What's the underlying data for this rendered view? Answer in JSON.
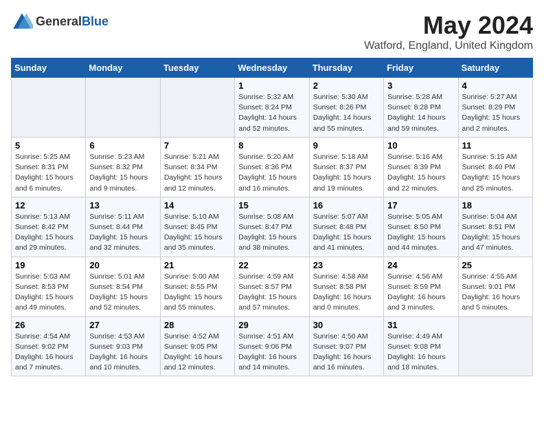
{
  "header": {
    "logo_general": "General",
    "logo_blue": "Blue",
    "month_title": "May 2024",
    "location": "Watford, England, United Kingdom"
  },
  "weekdays": [
    "Sunday",
    "Monday",
    "Tuesday",
    "Wednesday",
    "Thursday",
    "Friday",
    "Saturday"
  ],
  "weeks": [
    [
      {
        "day": "",
        "info": ""
      },
      {
        "day": "",
        "info": ""
      },
      {
        "day": "",
        "info": ""
      },
      {
        "day": "1",
        "info": "Sunrise: 5:32 AM\nSunset: 8:24 PM\nDaylight: 14 hours and 52 minutes."
      },
      {
        "day": "2",
        "info": "Sunrise: 5:30 AM\nSunset: 8:26 PM\nDaylight: 14 hours and 55 minutes."
      },
      {
        "day": "3",
        "info": "Sunrise: 5:28 AM\nSunset: 8:28 PM\nDaylight: 14 hours and 59 minutes."
      },
      {
        "day": "4",
        "info": "Sunrise: 5:27 AM\nSunset: 8:29 PM\nDaylight: 15 hours and 2 minutes."
      }
    ],
    [
      {
        "day": "5",
        "info": "Sunrise: 5:25 AM\nSunset: 8:31 PM\nDaylight: 15 hours and 6 minutes."
      },
      {
        "day": "6",
        "info": "Sunrise: 5:23 AM\nSunset: 8:32 PM\nDaylight: 15 hours and 9 minutes."
      },
      {
        "day": "7",
        "info": "Sunrise: 5:21 AM\nSunset: 8:34 PM\nDaylight: 15 hours and 12 minutes."
      },
      {
        "day": "8",
        "info": "Sunrise: 5:20 AM\nSunset: 8:36 PM\nDaylight: 15 hours and 16 minutes."
      },
      {
        "day": "9",
        "info": "Sunrise: 5:18 AM\nSunset: 8:37 PM\nDaylight: 15 hours and 19 minutes."
      },
      {
        "day": "10",
        "info": "Sunrise: 5:16 AM\nSunset: 8:39 PM\nDaylight: 15 hours and 22 minutes."
      },
      {
        "day": "11",
        "info": "Sunrise: 5:15 AM\nSunset: 8:40 PM\nDaylight: 15 hours and 25 minutes."
      }
    ],
    [
      {
        "day": "12",
        "info": "Sunrise: 5:13 AM\nSunset: 8:42 PM\nDaylight: 15 hours and 29 minutes."
      },
      {
        "day": "13",
        "info": "Sunrise: 5:11 AM\nSunset: 8:44 PM\nDaylight: 15 hours and 32 minutes."
      },
      {
        "day": "14",
        "info": "Sunrise: 5:10 AM\nSunset: 8:45 PM\nDaylight: 15 hours and 35 minutes."
      },
      {
        "day": "15",
        "info": "Sunrise: 5:08 AM\nSunset: 8:47 PM\nDaylight: 15 hours and 38 minutes."
      },
      {
        "day": "16",
        "info": "Sunrise: 5:07 AM\nSunset: 8:48 PM\nDaylight: 15 hours and 41 minutes."
      },
      {
        "day": "17",
        "info": "Sunrise: 5:05 AM\nSunset: 8:50 PM\nDaylight: 15 hours and 44 minutes."
      },
      {
        "day": "18",
        "info": "Sunrise: 5:04 AM\nSunset: 8:51 PM\nDaylight: 15 hours and 47 minutes."
      }
    ],
    [
      {
        "day": "19",
        "info": "Sunrise: 5:03 AM\nSunset: 8:53 PM\nDaylight: 15 hours and 49 minutes."
      },
      {
        "day": "20",
        "info": "Sunrise: 5:01 AM\nSunset: 8:54 PM\nDaylight: 15 hours and 52 minutes."
      },
      {
        "day": "21",
        "info": "Sunrise: 5:00 AM\nSunset: 8:55 PM\nDaylight: 15 hours and 55 minutes."
      },
      {
        "day": "22",
        "info": "Sunrise: 4:59 AM\nSunset: 8:57 PM\nDaylight: 15 hours and 57 minutes."
      },
      {
        "day": "23",
        "info": "Sunrise: 4:58 AM\nSunset: 8:58 PM\nDaylight: 16 hours and 0 minutes."
      },
      {
        "day": "24",
        "info": "Sunrise: 4:56 AM\nSunset: 8:59 PM\nDaylight: 16 hours and 3 minutes."
      },
      {
        "day": "25",
        "info": "Sunrise: 4:55 AM\nSunset: 9:01 PM\nDaylight: 16 hours and 5 minutes."
      }
    ],
    [
      {
        "day": "26",
        "info": "Sunrise: 4:54 AM\nSunset: 9:02 PM\nDaylight: 16 hours and 7 minutes."
      },
      {
        "day": "27",
        "info": "Sunrise: 4:53 AM\nSunset: 9:03 PM\nDaylight: 16 hours and 10 minutes."
      },
      {
        "day": "28",
        "info": "Sunrise: 4:52 AM\nSunset: 9:05 PM\nDaylight: 16 hours and 12 minutes."
      },
      {
        "day": "29",
        "info": "Sunrise: 4:51 AM\nSunset: 9:06 PM\nDaylight: 16 hours and 14 minutes."
      },
      {
        "day": "30",
        "info": "Sunrise: 4:50 AM\nSunset: 9:07 PM\nDaylight: 16 hours and 16 minutes."
      },
      {
        "day": "31",
        "info": "Sunrise: 4:49 AM\nSunset: 9:08 PM\nDaylight: 16 hours and 18 minutes."
      },
      {
        "day": "",
        "info": ""
      }
    ]
  ]
}
